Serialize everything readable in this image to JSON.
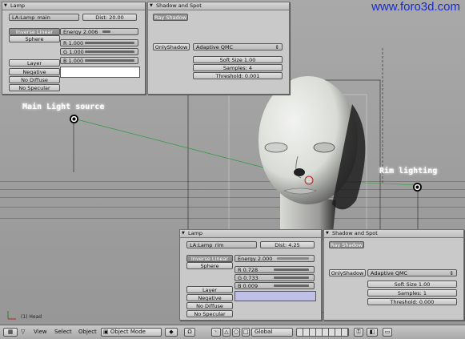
{
  "watermark": "www.foro3d.com",
  "viewport": {
    "label_main": "Main Light source",
    "label_rim": "Rim lighting",
    "object_name": "(1) Head",
    "axis_y": "Y",
    "axis_x": "X"
  },
  "top_lamp_panel": {
    "title": "Lamp",
    "lamp_name": "LA:Lamp_main",
    "dist": "Dist: 20.00",
    "falloff": "Inverse Linear",
    "sphere": "Sphere",
    "energy": "Energy 2.006",
    "energy_fill": 0.2,
    "r": "R 1.000",
    "g": "G 1.000",
    "b": "B 1.000",
    "layer": "Layer",
    "negative": "Negative",
    "no_diffuse": "No Diffuse",
    "no_specular": "No Specular",
    "color": "#ffffff"
  },
  "top_shadow_panel": {
    "title": "Shadow and Spot",
    "ray_shadow": "Ray Shadow",
    "only_shadow": "OnlyShadow",
    "sampling": "Adaptive QMC",
    "soft_size": "Soft Size 1.00",
    "samples": "Samples: 4",
    "threshold": "Threshold: 0.001"
  },
  "bottom_lamp_panel": {
    "title": "Lamp",
    "lamp_name": "LA:Lamp_rim",
    "dist": "Dist: 4.25",
    "falloff": "Inverse Linear",
    "sphere": "Sphere",
    "energy": "Energy 2.000",
    "energy_fill": 0.2,
    "r": "R 0.728",
    "g": "G 0.733",
    "b": "B 0.009",
    "layer": "Layer",
    "negative": "Negative",
    "no_diffuse": "No Diffuse",
    "no_specular": "No Specular",
    "color": "#bfbfe8"
  },
  "bottom_shadow_panel": {
    "title": "Shadow and Spot",
    "ray_shadow": "Ray Shadow",
    "only_shadow": "OnlyShadow",
    "sampling": "Adaptive QMC",
    "soft_size": "Soft Size 1.00",
    "samples": "Samples: 1",
    "threshold": "Threshold: 0.000"
  },
  "toolbar": {
    "view": "View",
    "select": "Select",
    "object": "Object",
    "mode": "Object Mode",
    "orientation": "Global"
  }
}
